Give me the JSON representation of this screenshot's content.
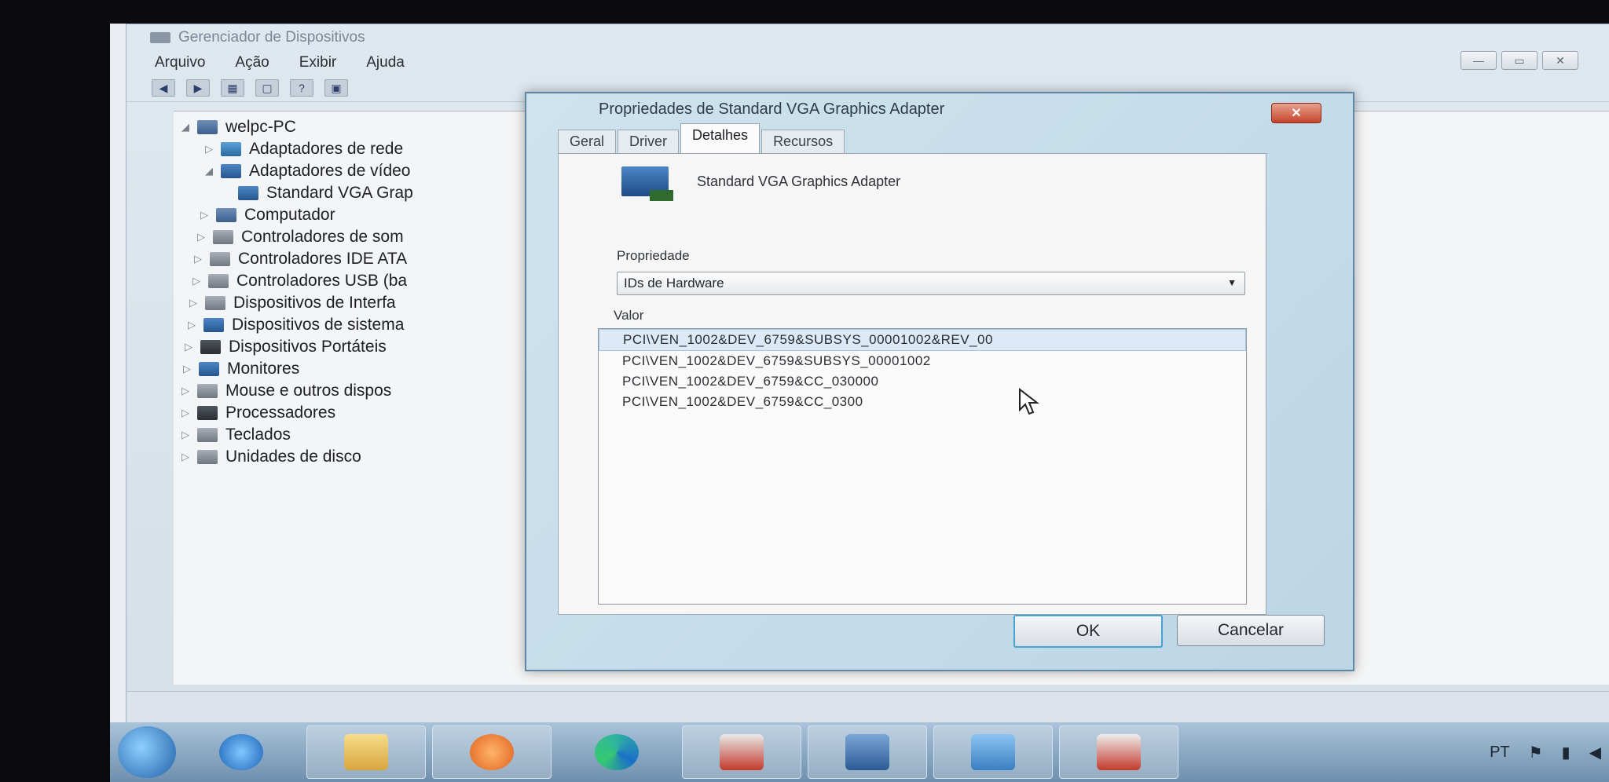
{
  "main_window": {
    "title": "Gerenciador de Dispositivos",
    "menu": [
      "Arquivo",
      "Ação",
      "Exibir",
      "Ajuda"
    ],
    "window_buttons": [
      "—",
      "▭",
      "✕"
    ],
    "tree": [
      {
        "label": "welpc-PC",
        "expanded": true,
        "icon": "computer-icon"
      },
      {
        "label": "Adaptadores de rede",
        "icon": "network-icon"
      },
      {
        "label": "Adaptadores de vídeo",
        "expanded": true,
        "icon": "display-adapter-icon"
      },
      {
        "label": "Standard VGA Grap",
        "icon": "display-adapter-icon"
      },
      {
        "label": "Computador",
        "icon": "computer-icon"
      },
      {
        "label": "Controladores de som",
        "icon": "speaker-icon"
      },
      {
        "label": "Controladores IDE ATA",
        "icon": "ide-icon"
      },
      {
        "label": "Controladores USB (ba",
        "icon": "usb-icon"
      },
      {
        "label": "Dispositivos de Interfa",
        "icon": "hid-icon"
      },
      {
        "label": "Dispositivos de sistema",
        "icon": "system-icon"
      },
      {
        "label": "Dispositivos Portáteis",
        "icon": "portable-icon"
      },
      {
        "label": "Monitores",
        "icon": "monitor-icon"
      },
      {
        "label": "Mouse e outros dispos",
        "icon": "mouse-icon"
      },
      {
        "label": "Processadores",
        "icon": "processor-icon"
      },
      {
        "label": "Teclados",
        "icon": "keyboard-icon"
      },
      {
        "label": "Unidades de disco",
        "icon": "disk-icon"
      }
    ]
  },
  "dialog": {
    "title": "Propriedades de Standard VGA Graphics Adapter",
    "close_label": "✕",
    "tabs": [
      "Geral",
      "Driver",
      "Detalhes",
      "Recursos"
    ],
    "active_tab": "Detalhes",
    "device_name": "Standard VGA Graphics Adapter",
    "property_label": "Propriedade",
    "property_value": "IDs de Hardware",
    "value_label": "Valor",
    "values": [
      "PCI\\VEN_1002&DEV_6759&SUBSYS_00001002&REV_00",
      "PCI\\VEN_1002&DEV_6759&SUBSYS_00001002",
      "PCI\\VEN_1002&DEV_6759&CC_030000",
      "PCI\\VEN_1002&DEV_6759&CC_0300"
    ],
    "ok_label": "OK",
    "cancel_label": "Cancelar"
  },
  "taskbar": {
    "language": "PT"
  }
}
